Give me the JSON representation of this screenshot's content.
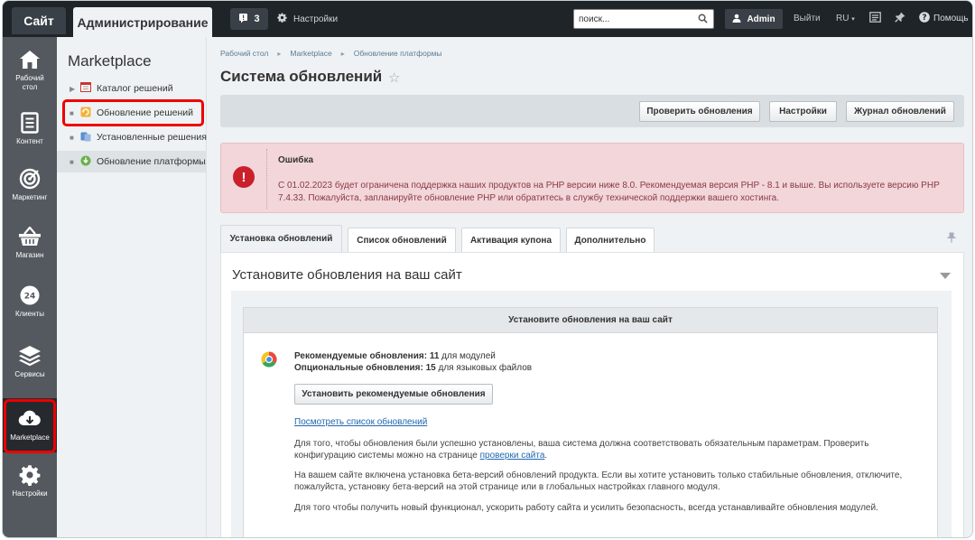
{
  "topbar": {
    "site_tab": "Сайт",
    "admin_tab": "Администрирование",
    "notifications_count": "3",
    "settings_label": "Настройки",
    "search_placeholder": "поиск...",
    "user_name": "Admin",
    "exit_label": "Выйти",
    "lang_label": "RU",
    "help_label": "Помощь"
  },
  "rail": {
    "items": [
      {
        "label": "Рабочий стол",
        "icon": "home-icon"
      },
      {
        "label": "Контент",
        "icon": "document-icon"
      },
      {
        "label": "Маркетинг",
        "icon": "target-icon"
      },
      {
        "label": "Магазин",
        "icon": "basket-icon"
      },
      {
        "label": "Клиенты",
        "icon": "clock-24-icon"
      },
      {
        "label": "Сервисы",
        "icon": "layers-icon"
      },
      {
        "label": "Marketplace",
        "icon": "cloud-download-icon"
      },
      {
        "label": "Настройки",
        "icon": "gear-icon"
      }
    ]
  },
  "submenu": {
    "title": "Marketplace",
    "items": [
      {
        "label": "Каталог решений",
        "icon": "calendar-icon"
      },
      {
        "label": "Обновление решений",
        "icon": "refresh-solutions-icon"
      },
      {
        "label": "Установленные решения",
        "icon": "installed-icon"
      },
      {
        "label": "Обновление платформы",
        "icon": "platform-update-icon"
      }
    ]
  },
  "breadcrumb": [
    "Рабочий стол",
    "Marketplace",
    "Обновление платформы"
  ],
  "page_title": "Система обновлений",
  "toolbar": {
    "check_updates": "Проверить обновления",
    "settings": "Настройки",
    "log": "Журнал обновлений"
  },
  "error": {
    "title": "Ошибка",
    "text": "С 01.02.2023 будет ограничена поддержка наших продуктов на PHP версии ниже 8.0. Рекомендуемая версия PHP - 8.1 и выше. Вы используете версию PHP 7.4.33. Пожалуйста, запланируйте обновление PHP или обратитесь в службу технической поддержки вашего хостинга."
  },
  "tabs": [
    "Установка обновлений",
    "Список обновлений",
    "Активация купона",
    "Дополнительно"
  ],
  "panel": {
    "title": "Установите обновления на ваш сайт",
    "inner_title": "Установите обновления на ваш сайт",
    "recommended_label": "Рекомендуемые обновления:",
    "recommended_count": "11",
    "recommended_suffix": "для модулей",
    "optional_label": "Опциональные обновления:",
    "optional_count": "15",
    "optional_suffix": "для языковых файлов",
    "install_button": "Установить рекомендуемые обновления",
    "view_list_link": "Посмотреть список обновлений",
    "para1_text": "Для того, чтобы обновления были успешно установлены, ваша система должна соответствовать обязательным параметрам. Проверить конфигурацию системы можно на странице",
    "para1_link": "проверки сайта",
    "para1_end": ".",
    "para2": "На вашем сайте включена установка бета-версий обновлений продукта. Если вы хотите установить только стабильные обновления, отключите, пожалуйста, установку бета-версий на этой странице или в глобальных настройках главного модуля.",
    "para3": "Для того чтобы получить новый функционал, ускорить работу сайта и усилить безопасность, всегда устанавливайте обновления модулей."
  },
  "colors": {
    "topbar_bg": "#1f2429",
    "rail_bg": "#53595f",
    "error_bg": "#f2d6da",
    "error_icon": "#c9202c",
    "highlight": "#e00000",
    "link": "#2067b0"
  }
}
